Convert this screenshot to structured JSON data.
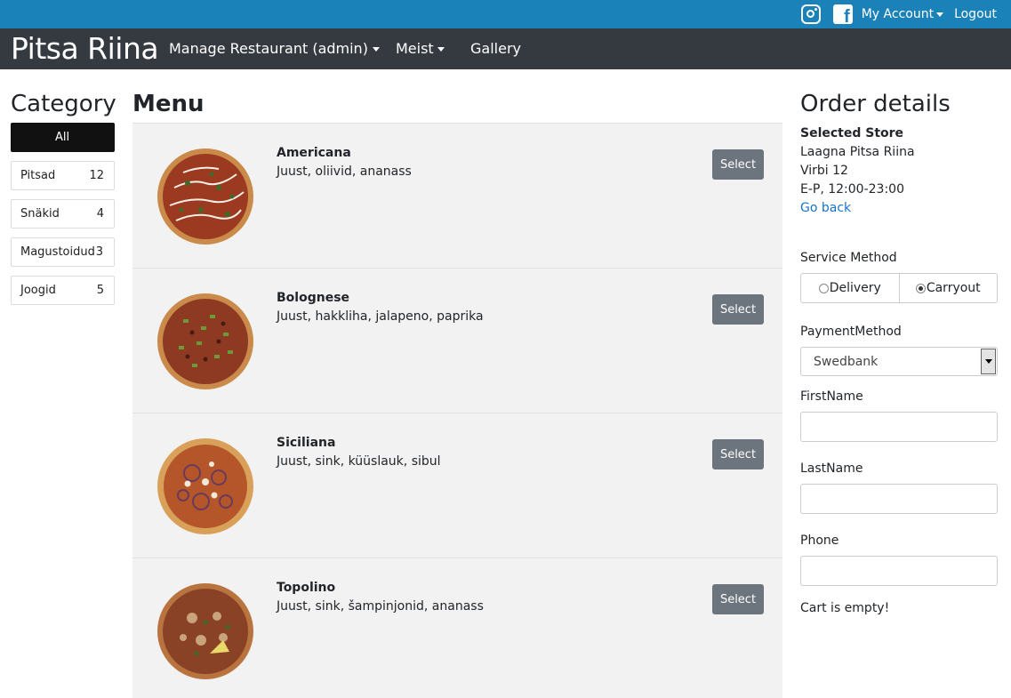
{
  "topbar": {
    "my_account": "My Account",
    "logout": "Logout",
    "bg_color": "#1a82b8"
  },
  "navbar": {
    "brand": "Pitsa Riina",
    "manage": "Manage Restaurant (admin)",
    "meist": "Meist",
    "gallery": "Gallery"
  },
  "category": {
    "title": "Category",
    "items": [
      {
        "label": "All",
        "count": ""
      },
      {
        "label": "Pitsad",
        "count": "12"
      },
      {
        "label": "Snäkid",
        "count": "4"
      },
      {
        "label": "Magustoidud",
        "count": "3"
      },
      {
        "label": "Joogid",
        "count": "5"
      }
    ]
  },
  "menu": {
    "title": "Menu",
    "select_label": "Select",
    "items": [
      {
        "name": "Americana",
        "desc": "Juust, oliivid, ananass"
      },
      {
        "name": "Bolognese",
        "desc": "Juust, hakkliha, jalapeno, paprika"
      },
      {
        "name": "Siciliana",
        "desc": "Juust, sink, küüslauk, sibul"
      },
      {
        "name": "Topolino",
        "desc": "Juust, sink, šampinjonid, ananass"
      }
    ]
  },
  "order": {
    "title": "Order details",
    "selected_store_label": "Selected Store",
    "store_name": "Laagna Pitsa Riina",
    "store_address": "Virbi 12",
    "store_hours": "E-P, 12:00-23:00",
    "go_back": "Go back",
    "service_method_label": "Service Method",
    "delivery": "Delivery",
    "carryout": "Carryout",
    "payment_label": "PaymentMethod",
    "payment_value": "Swedbank",
    "firstname_label": "FirstName",
    "lastname_label": "LastName",
    "phone_label": "Phone",
    "cart_status": "Cart is empty!"
  }
}
